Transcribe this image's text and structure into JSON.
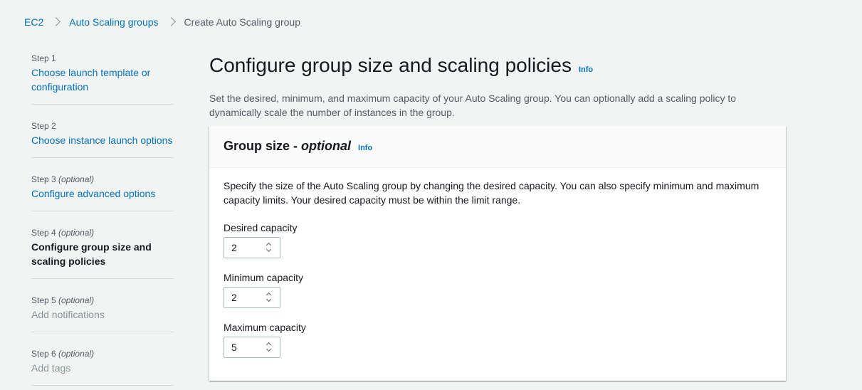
{
  "breadcrumb": {
    "items": [
      "EC2",
      "Auto Scaling groups"
    ],
    "current": "Create Auto Scaling group"
  },
  "steps": [
    {
      "number": "Step 1",
      "optional": "",
      "title": "Choose launch template or configuration",
      "state": "link"
    },
    {
      "number": "Step 2",
      "optional": "",
      "title": "Choose instance launch options",
      "state": "link"
    },
    {
      "number": "Step 3",
      "optional": "(optional)",
      "title": "Configure advanced options",
      "state": "link"
    },
    {
      "number": "Step 4",
      "optional": "(optional)",
      "title": "Configure group size and scaling policies",
      "state": "active"
    },
    {
      "number": "Step 5",
      "optional": "(optional)",
      "title": "Add notifications",
      "state": "disabled"
    },
    {
      "number": "Step 6",
      "optional": "(optional)",
      "title": "Add tags",
      "state": "disabled"
    }
  ],
  "main": {
    "title": "Configure group size and scaling policies",
    "info": "Info",
    "description": "Set the desired, minimum, and maximum capacity of your Auto Scaling group. You can optionally add a scaling policy to dynamically scale the number of instances in the group."
  },
  "panel": {
    "title_prefix": "Group size - ",
    "title_optional": "optional",
    "info": "Info",
    "description": "Specify the size of the Auto Scaling group by changing the desired capacity. You can also specify minimum and maximum capacity limits. Your desired capacity must be within the limit range.",
    "fields": [
      {
        "label": "Desired capacity",
        "value": "2"
      },
      {
        "label": "Minimum capacity",
        "value": "2"
      },
      {
        "label": "Maximum capacity",
        "value": "5"
      }
    ]
  },
  "colors": {
    "link": "#0073bb",
    "background": "#f2f3f3",
    "text": "#16191f",
    "muted": "#545b64",
    "disabled": "#879596"
  }
}
